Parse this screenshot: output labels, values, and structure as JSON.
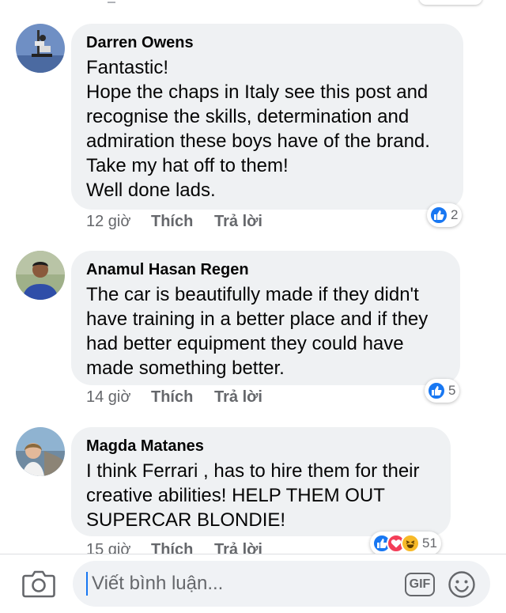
{
  "comments": [
    {
      "author": "Darren Owens",
      "text": "Fantastic!\nHope the chaps in Italy see this post and\nrecognise the skills, determination and\nadmiration these boys have of the brand.\nTake my hat off to them!\nWell done lads.",
      "time": "12 giờ",
      "like_label": "Thích",
      "reply_label": "Trả lời",
      "reaction_count": "2"
    },
    {
      "author": "Anamul Hasan Regen",
      "text": "The car is beautifully made if they didn't\nhave training in a better place and if they\nhad better equipment they could have\nmade something better.",
      "time": "14 giờ",
      "like_label": "Thích",
      "reply_label": "Trả lời",
      "reaction_count": "5"
    },
    {
      "author": "Magda Matanes",
      "text": "I think Ferrari , has to hire them for their\ncreative abilities! HELP THEM OUT\nSUPERCAR BLONDIE!",
      "time": "15 giờ",
      "like_label": "Thích",
      "reply_label": "Trả lời",
      "reaction_count": "51"
    }
  ],
  "composer": {
    "placeholder": "Viết bình luận...",
    "gif_label": "GIF"
  },
  "colors": {
    "like_blue": "#1877f2",
    "love_red": "#f33e58",
    "haha_yellow": "#f7b928",
    "bubble_bg": "#eff1f3",
    "meta_gray": "#65676b"
  },
  "icons": [
    "camera-icon",
    "gif-icon",
    "emoji-icon",
    "like-reaction-icon",
    "love-reaction-icon",
    "haha-reaction-icon"
  ]
}
